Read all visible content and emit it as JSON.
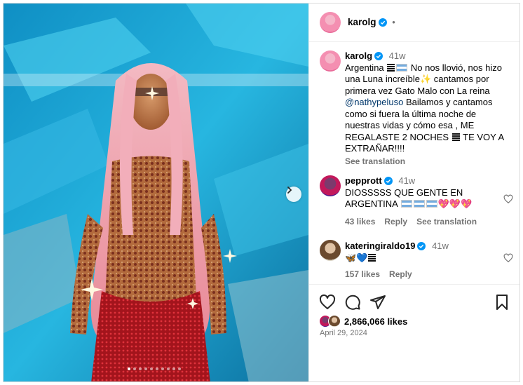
{
  "post": {
    "username": "karolg",
    "header_dot": "•",
    "caption_time": "41w",
    "caption_part1": "Argentina",
    "caption_part2": "No nos llovió, nos hizo una Luna increíble",
    "caption_part3": "cantamos por primera vez Gato Malo con La reina",
    "caption_mention": "@nathypeluso",
    "caption_part4": "Bailamos y cantamos como si fuera la última noche de nuestras vidas y cómo esa , ME REGALASTE 2 NOCHES",
    "caption_part5": "TE VOY A EXTRAÑAR!!!!",
    "see_translation": "See translation",
    "likes_count": "2,866,066 likes",
    "date": "April 29, 2024"
  },
  "comments": [
    {
      "username": "pepprott",
      "time": "41w",
      "text": "DIOSSSSS QUE GENTE EN ARGENTINA",
      "likes": "43 likes",
      "reply": "Reply",
      "see_translation": "See translation"
    },
    {
      "username": "kateringiraldo19",
      "time": "41w",
      "text": "🦋💙",
      "likes": "157 likes",
      "reply": "Reply"
    }
  ],
  "carousel": {
    "slide_count": 10,
    "active_index": 0
  },
  "icons": {
    "verified": "verified-badge-icon",
    "heart": "heart-icon",
    "comment": "comment-icon",
    "share": "share-icon",
    "bookmark": "bookmark-icon",
    "next": "chevron-right-icon"
  },
  "colors": {
    "verified": "#0095f6",
    "link": "#00376b",
    "muted": "#737373"
  }
}
